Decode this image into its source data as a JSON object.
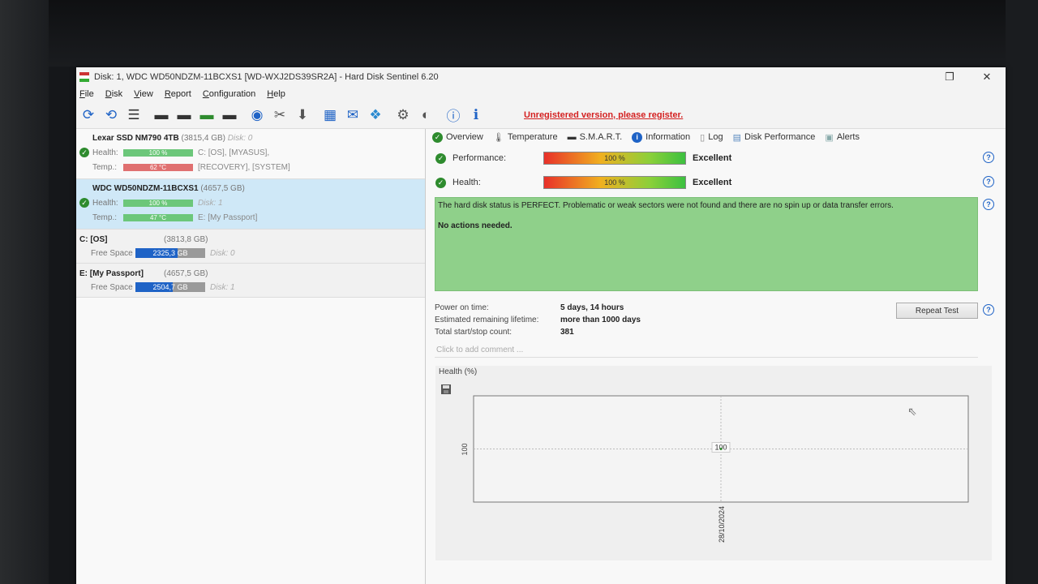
{
  "window": {
    "title": "Disk: 1, WDC WD50NDZM-11BCXS1 [WD-WXJ2DS39SR2A]  -  Hard Disk Sentinel 6.20",
    "restore_glyph": "❐",
    "close_glyph": "✕"
  },
  "menu": [
    "File",
    "Disk",
    "View",
    "Report",
    "Configuration",
    "Help"
  ],
  "toolbar": {
    "unregistered_text": "Unregistered version, please register."
  },
  "disks": [
    {
      "name": "Lexar SSD NM790 4TB",
      "size": "(3815,4 GB)",
      "disk_ref": "Disk: 0",
      "health_label": "Health:",
      "health_value": "100 %",
      "health_side": "C: [OS],  [MYASUS],",
      "temp_label": "Temp.:",
      "temp_value": "62 °C",
      "temp_side": "[RECOVERY],  [SYSTEM]"
    },
    {
      "name": "WDC WD50NDZM-11BCXS1",
      "size": "(4657,5 GB)",
      "disk_ref": "Disk: 1",
      "health_label": "Health:",
      "health_value": "100 %",
      "health_side": "",
      "temp_label": "Temp.:",
      "temp_value": "47 °C",
      "temp_side": "E: [My Passport]"
    }
  ],
  "volumes": [
    {
      "name": "C: [OS]",
      "size": "(3813,8 GB)",
      "free_label": "Free Space",
      "free_value": "2325,3 GB",
      "free_fraction": 0.61,
      "disk_ref": "Disk: 0"
    },
    {
      "name": "E: [My Passport]",
      "size": "(4657,5 GB)",
      "free_label": "Free Space",
      "free_value": "2504,7 GB",
      "free_fraction": 0.54,
      "disk_ref": "Disk: 1"
    }
  ],
  "tabs": [
    "Overview",
    "Temperature",
    "S.M.A.R.T.",
    "Information",
    "Log",
    "Disk Performance",
    "Alerts"
  ],
  "overview": {
    "performance_label": "Performance:",
    "performance_value": "100 %",
    "performance_rating": "Excellent",
    "health_label": "Health:",
    "health_value": "100 %",
    "health_rating": "Excellent",
    "status_text": "The hard disk status is PERFECT. Problematic or weak sectors were not found and there are no spin up or data transfer errors.",
    "actions_text": "No actions needed.",
    "power_on_label": "Power on time:",
    "power_on_value": "5 days, 14 hours",
    "lifetime_label": "Estimated remaining lifetime:",
    "lifetime_value": "more than 1000 days",
    "startstop_label": "Total start/stop count:",
    "startstop_value": "381",
    "repeat_test_label": "Repeat Test",
    "comment_placeholder": "Click to add comment ..."
  },
  "colors": {
    "status_bg": "#8fd08a",
    "selected_bg": "#cfe8f7",
    "accent_blue": "#1f63c6",
    "warning_red": "#d42020"
  },
  "chart_data": {
    "type": "line",
    "title": "Health (%)",
    "x": [
      "28/10/2024"
    ],
    "series": [
      {
        "values": [
          100
        ]
      }
    ],
    "y_tick": "100",
    "data_label": "100"
  }
}
